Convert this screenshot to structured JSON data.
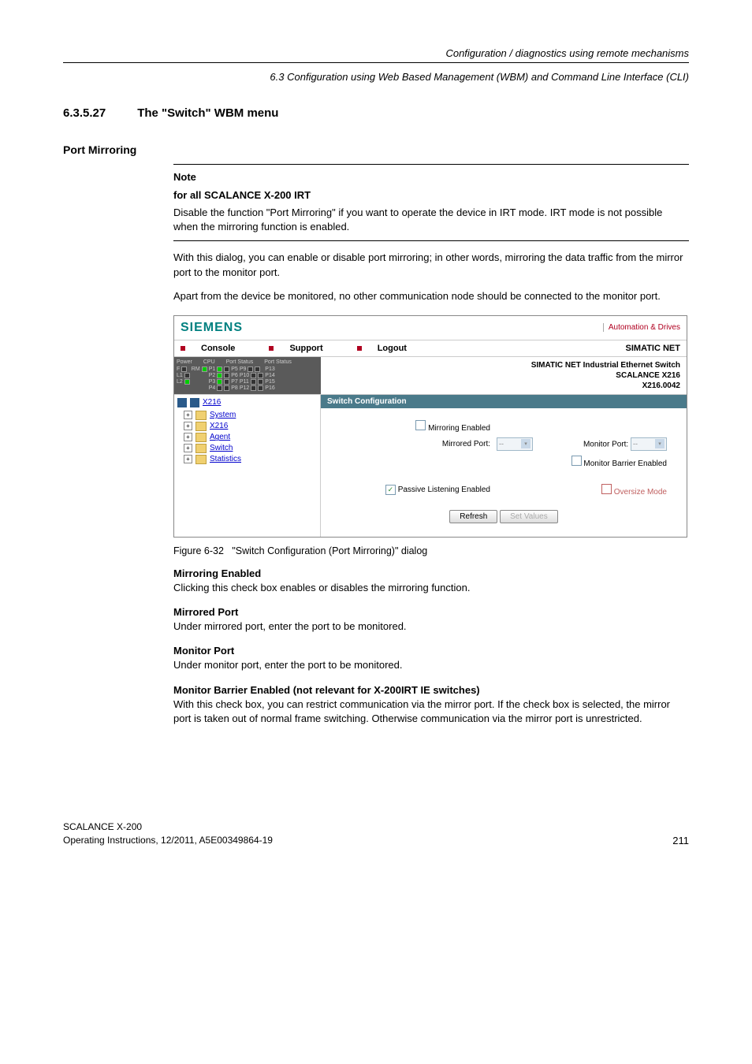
{
  "header": {
    "chapter": "Configuration / diagnostics using remote mechanisms",
    "section": "6.3 Configuration using Web Based Management (WBM) and Command Line Interface (CLI)"
  },
  "title": {
    "number": "6.3.5.27",
    "text": "The \"Switch\" WBM menu"
  },
  "subsection": "Port Mirroring",
  "note": {
    "label": "Note",
    "subtitle": "for all SCALANCE X-200 IRT",
    "body": "Disable the function \"Port Mirroring\" if you want to operate the device in IRT mode. IRT mode is not possible when the mirroring function is enabled."
  },
  "para1": "With this dialog, you can enable or disable port mirroring; in other words, mirroring the data traffic from the mirror port to the monitor port.",
  "para2": "Apart from the device be monitored, no other communication node should be connected to the monitor port.",
  "screenshot": {
    "brand": "SIEMENS",
    "tagline": "Automation & Drives",
    "links": {
      "console": "Console",
      "support": "Support",
      "logout": "Logout"
    },
    "brand2": "SIMATIC NET",
    "devicePanel": {
      "power": "Power",
      "cpu": "CPU",
      "portStatus1": "Port Status",
      "portStatus2": "Port Status",
      "col1": [
        "F",
        "L1",
        "L2"
      ],
      "col2": [
        "RM"
      ],
      "col3": [
        "P1",
        "P2",
        "P3",
        "P4"
      ],
      "col4": [
        "P5",
        "P6",
        "P7",
        "P8"
      ],
      "col5": [
        "P9",
        "P10",
        "P11",
        "P12"
      ],
      "col6": [
        "P13",
        "P14",
        "P15",
        "P16"
      ]
    },
    "deviceInfo": {
      "line1": "SIMATIC NET Industrial Ethernet Switch",
      "line2": "SCALANCE X216",
      "line3": "X216.0042"
    },
    "nav": {
      "root": "X216",
      "items": [
        "System",
        "X216",
        "Agent",
        "Switch",
        "Statistics"
      ]
    },
    "content": {
      "title": "Switch Configuration",
      "mirroringEnabled": "Mirroring Enabled",
      "mirroredPort": "Mirrored Port:",
      "mirroredPortVal": "--",
      "monitorPort": "Monitor Port:",
      "monitorPortVal": "--",
      "monitorBarrier": "Monitor Barrier Enabled",
      "passiveListening": "Passive Listening Enabled",
      "oversizeMode": "Oversize Mode",
      "refresh": "Refresh",
      "setValues": "Set Values"
    }
  },
  "figureCaption": {
    "num": "Figure 6-32",
    "text": "\"Switch Configuration (Port Mirroring)\" dialog"
  },
  "defs": {
    "mirroringEnabled": {
      "term": "Mirroring Enabled",
      "body": "Clicking this check box enables or disables the mirroring function."
    },
    "mirroredPort": {
      "term": "Mirrored Port",
      "body": "Under mirrored port, enter the port to be monitored."
    },
    "monitorPort": {
      "term": "Monitor Port",
      "body": "Under monitor port, enter the port to be monitored."
    },
    "monitorBarrier": {
      "term": "Monitor Barrier Enabled (not relevant for X-200IRT IE switches)",
      "body": "With this check box, you can restrict communication via the mirror port. If the check box is selected, the mirror port is taken out of normal frame switching. Otherwise communication via the mirror port is unrestricted."
    }
  },
  "footer": {
    "product": "SCALANCE X-200",
    "docline": "Operating Instructions, 12/2011, A5E00349864-19",
    "pageNum": "211"
  }
}
